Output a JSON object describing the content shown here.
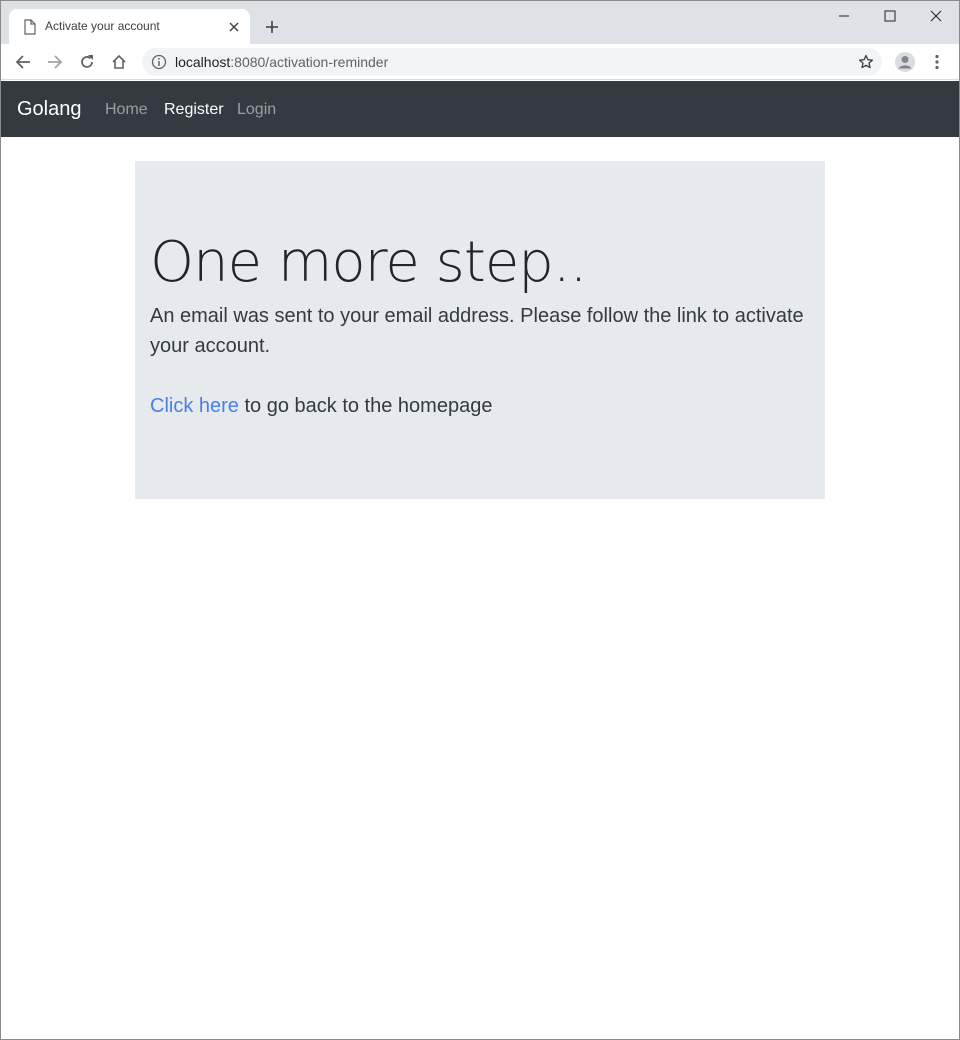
{
  "browser": {
    "tab_title": "Activate your account",
    "url_host": "localhost",
    "url_rest": ":8080/activation-reminder"
  },
  "navbar": {
    "brand": "Golang",
    "links": [
      {
        "label": "Home"
      },
      {
        "label": "Register",
        "active": true
      },
      {
        "label": "Login"
      }
    ],
    "background": "#343a40"
  },
  "jumbotron": {
    "heading": "One more step..",
    "message": "An email was sent to your email address. Please follow the link to activate your account.",
    "link_text": "Click here",
    "link_suffix": " to go back to the homepage",
    "background": "#e9ecef",
    "link_color": "#4a7fe5"
  }
}
